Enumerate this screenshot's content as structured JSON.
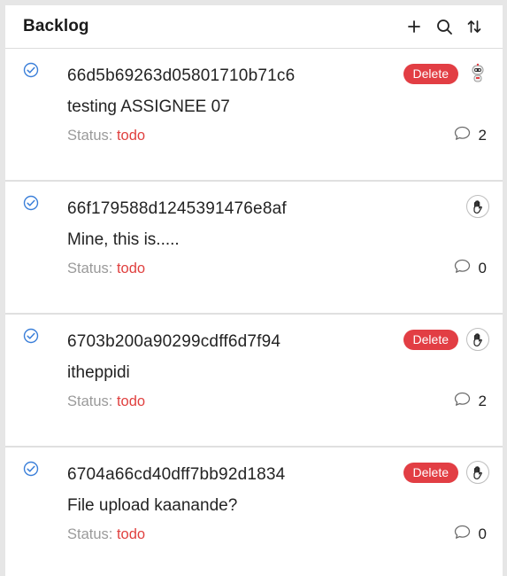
{
  "header": {
    "title": "Backlog",
    "icons": [
      "plus-icon",
      "search-icon",
      "sort-icon"
    ]
  },
  "status_label": "Status:",
  "colors": {
    "status_todo": "#e0403f",
    "delete": "#e23e44",
    "check": "#3b7fd9"
  },
  "tasks": [
    {
      "id": "66d5b69263d05801710b71c6",
      "title": "testing ASSIGNEE 07",
      "status": "todo",
      "delete_label": "Delete",
      "assignee_icon": "robot-avatar",
      "comments": "2"
    },
    {
      "id": "66f179588d1245391476e8af",
      "title": "Mine, this is.....",
      "status": "todo",
      "assignee_icon": "hand-icon",
      "comments": "0"
    },
    {
      "id": "6703b200a90299cdff6d7f94",
      "title": "itheppidi",
      "status": "todo",
      "delete_label": "Delete",
      "assignee_icon": "hand-icon",
      "comments": "2"
    },
    {
      "id": "6704a66cd40dff7bb92d1834",
      "title": "File upload kaanande?",
      "status": "todo",
      "delete_label": "Delete",
      "assignee_icon": "hand-icon",
      "comments": "0"
    }
  ]
}
